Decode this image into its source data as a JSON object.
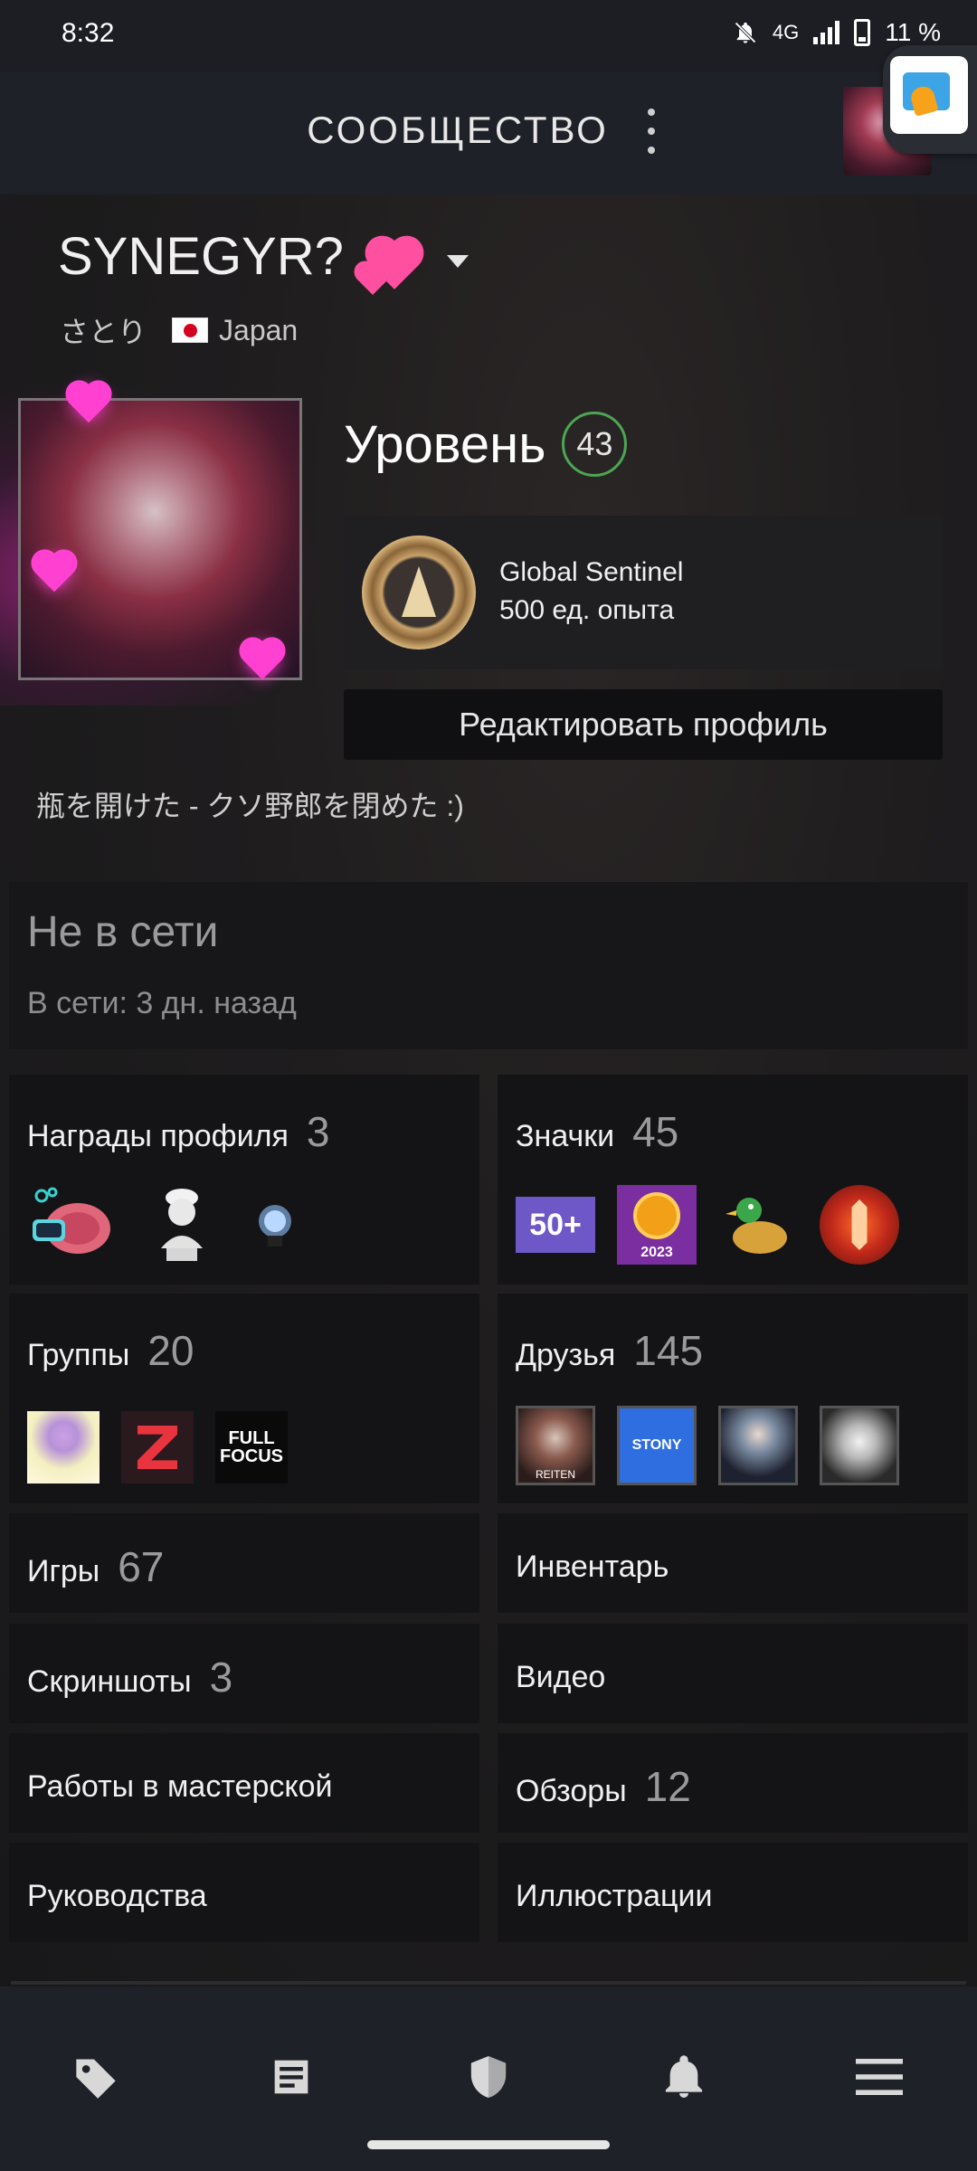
{
  "status_bar": {
    "time": "8:32",
    "network": "4G",
    "battery": "11 %"
  },
  "header": {
    "title": "СООБЩЕСТВО"
  },
  "profile": {
    "name": "SYNEGYR?",
    "real_name": "さとり",
    "country": "Japan",
    "level_label": "Уровень",
    "level": "43",
    "badge_name": "Global Sentinel",
    "badge_xp": "500 ед. опыта",
    "edit_button": "Редактировать профиль",
    "summary": "瓶を開けた - クソ野郎を閉めた :)"
  },
  "status": {
    "title": "Не в сети",
    "last_online": "В сети: 3 дн. назад"
  },
  "sections": {
    "awards": {
      "label": "Награды профиля",
      "count": "3"
    },
    "badges": {
      "label": "Значки",
      "count": "45",
      "first_badge_text": "50+",
      "steam_year": "2023"
    },
    "groups": {
      "label": "Группы",
      "count": "20",
      "full_focus_text": "FULL FOCUS"
    },
    "friends": {
      "label": "Друзья",
      "count": "145",
      "friend1_text": "REITEN",
      "friend2_text": "STONY"
    },
    "games": {
      "label": "Игры",
      "count": "67"
    },
    "inventory": {
      "label": "Инвентарь"
    },
    "screenshots": {
      "label": "Скриншоты",
      "count": "3"
    },
    "videos": {
      "label": "Видео"
    },
    "workshop": {
      "label": "Работы в мастерской"
    },
    "reviews": {
      "label": "Обзоры",
      "count": "12"
    },
    "guides": {
      "label": "Руководства"
    },
    "artwork": {
      "label": "Иллюстрации"
    }
  },
  "nav": {
    "items": [
      "store-tag-icon",
      "news-icon",
      "shield-icon",
      "bell-icon",
      "menu-icon"
    ]
  }
}
